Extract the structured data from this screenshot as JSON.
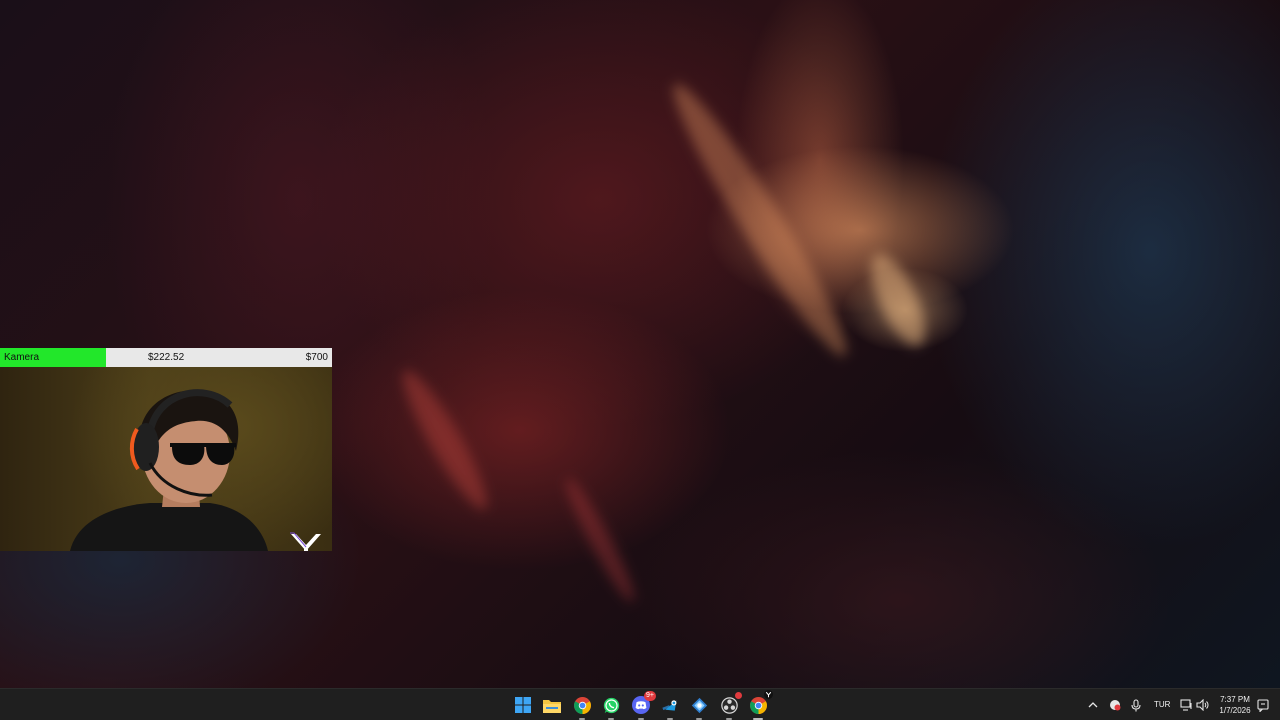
{
  "overlay": {
    "label": "Kamera",
    "current_amount": "$222.52",
    "goal_amount": "$700",
    "progress_fraction": 0.318,
    "progress_color": "#22e72a",
    "logo": "y-logo"
  },
  "taskbar": {
    "apps": [
      {
        "name": "start-button",
        "icon": "windows-logo-icon",
        "running": false
      },
      {
        "name": "file-explorer",
        "icon": "folder-icon",
        "running": false
      },
      {
        "name": "chrome",
        "icon": "chrome-icon",
        "running": true
      },
      {
        "name": "whatsapp",
        "icon": "whatsapp-icon",
        "running": true
      },
      {
        "name": "discord",
        "icon": "discord-icon",
        "running": true,
        "badge": "9+"
      },
      {
        "name": "steam",
        "icon": "steam-icon",
        "running": true
      },
      {
        "name": "app-blue-gem",
        "icon": "gem-icon",
        "running": true
      },
      {
        "name": "obs-studio",
        "icon": "obs-icon",
        "running": true,
        "badge_dot": true
      },
      {
        "name": "chrome-profile",
        "icon": "chrome-icon",
        "running": true,
        "active": true
      }
    ],
    "tray": {
      "language": "TUR",
      "time": "7:37 PM",
      "date": "1/7/2026"
    }
  }
}
